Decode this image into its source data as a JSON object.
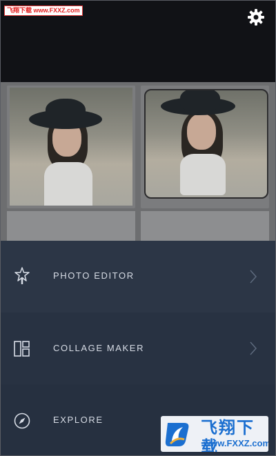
{
  "watermark_top": {
    "text": "飞翔下载 www.FXXZ.com"
  },
  "settings": {
    "icon": "gear-icon"
  },
  "menu": {
    "items": [
      {
        "label": "PHOTO EDITOR",
        "icon": "magic-wand-icon"
      },
      {
        "label": "COLLAGE MAKER",
        "icon": "collage-grid-icon"
      },
      {
        "label": "EXPLORE",
        "icon": "compass-icon"
      }
    ]
  },
  "badge": {
    "title": "飞翔下载",
    "url": "www.FXXZ.com"
  },
  "colors": {
    "menu_bg": "#2a3444",
    "label": "#d8dde6",
    "badge_text": "#1b6fd0",
    "watermark_red": "#e01b1b"
  }
}
